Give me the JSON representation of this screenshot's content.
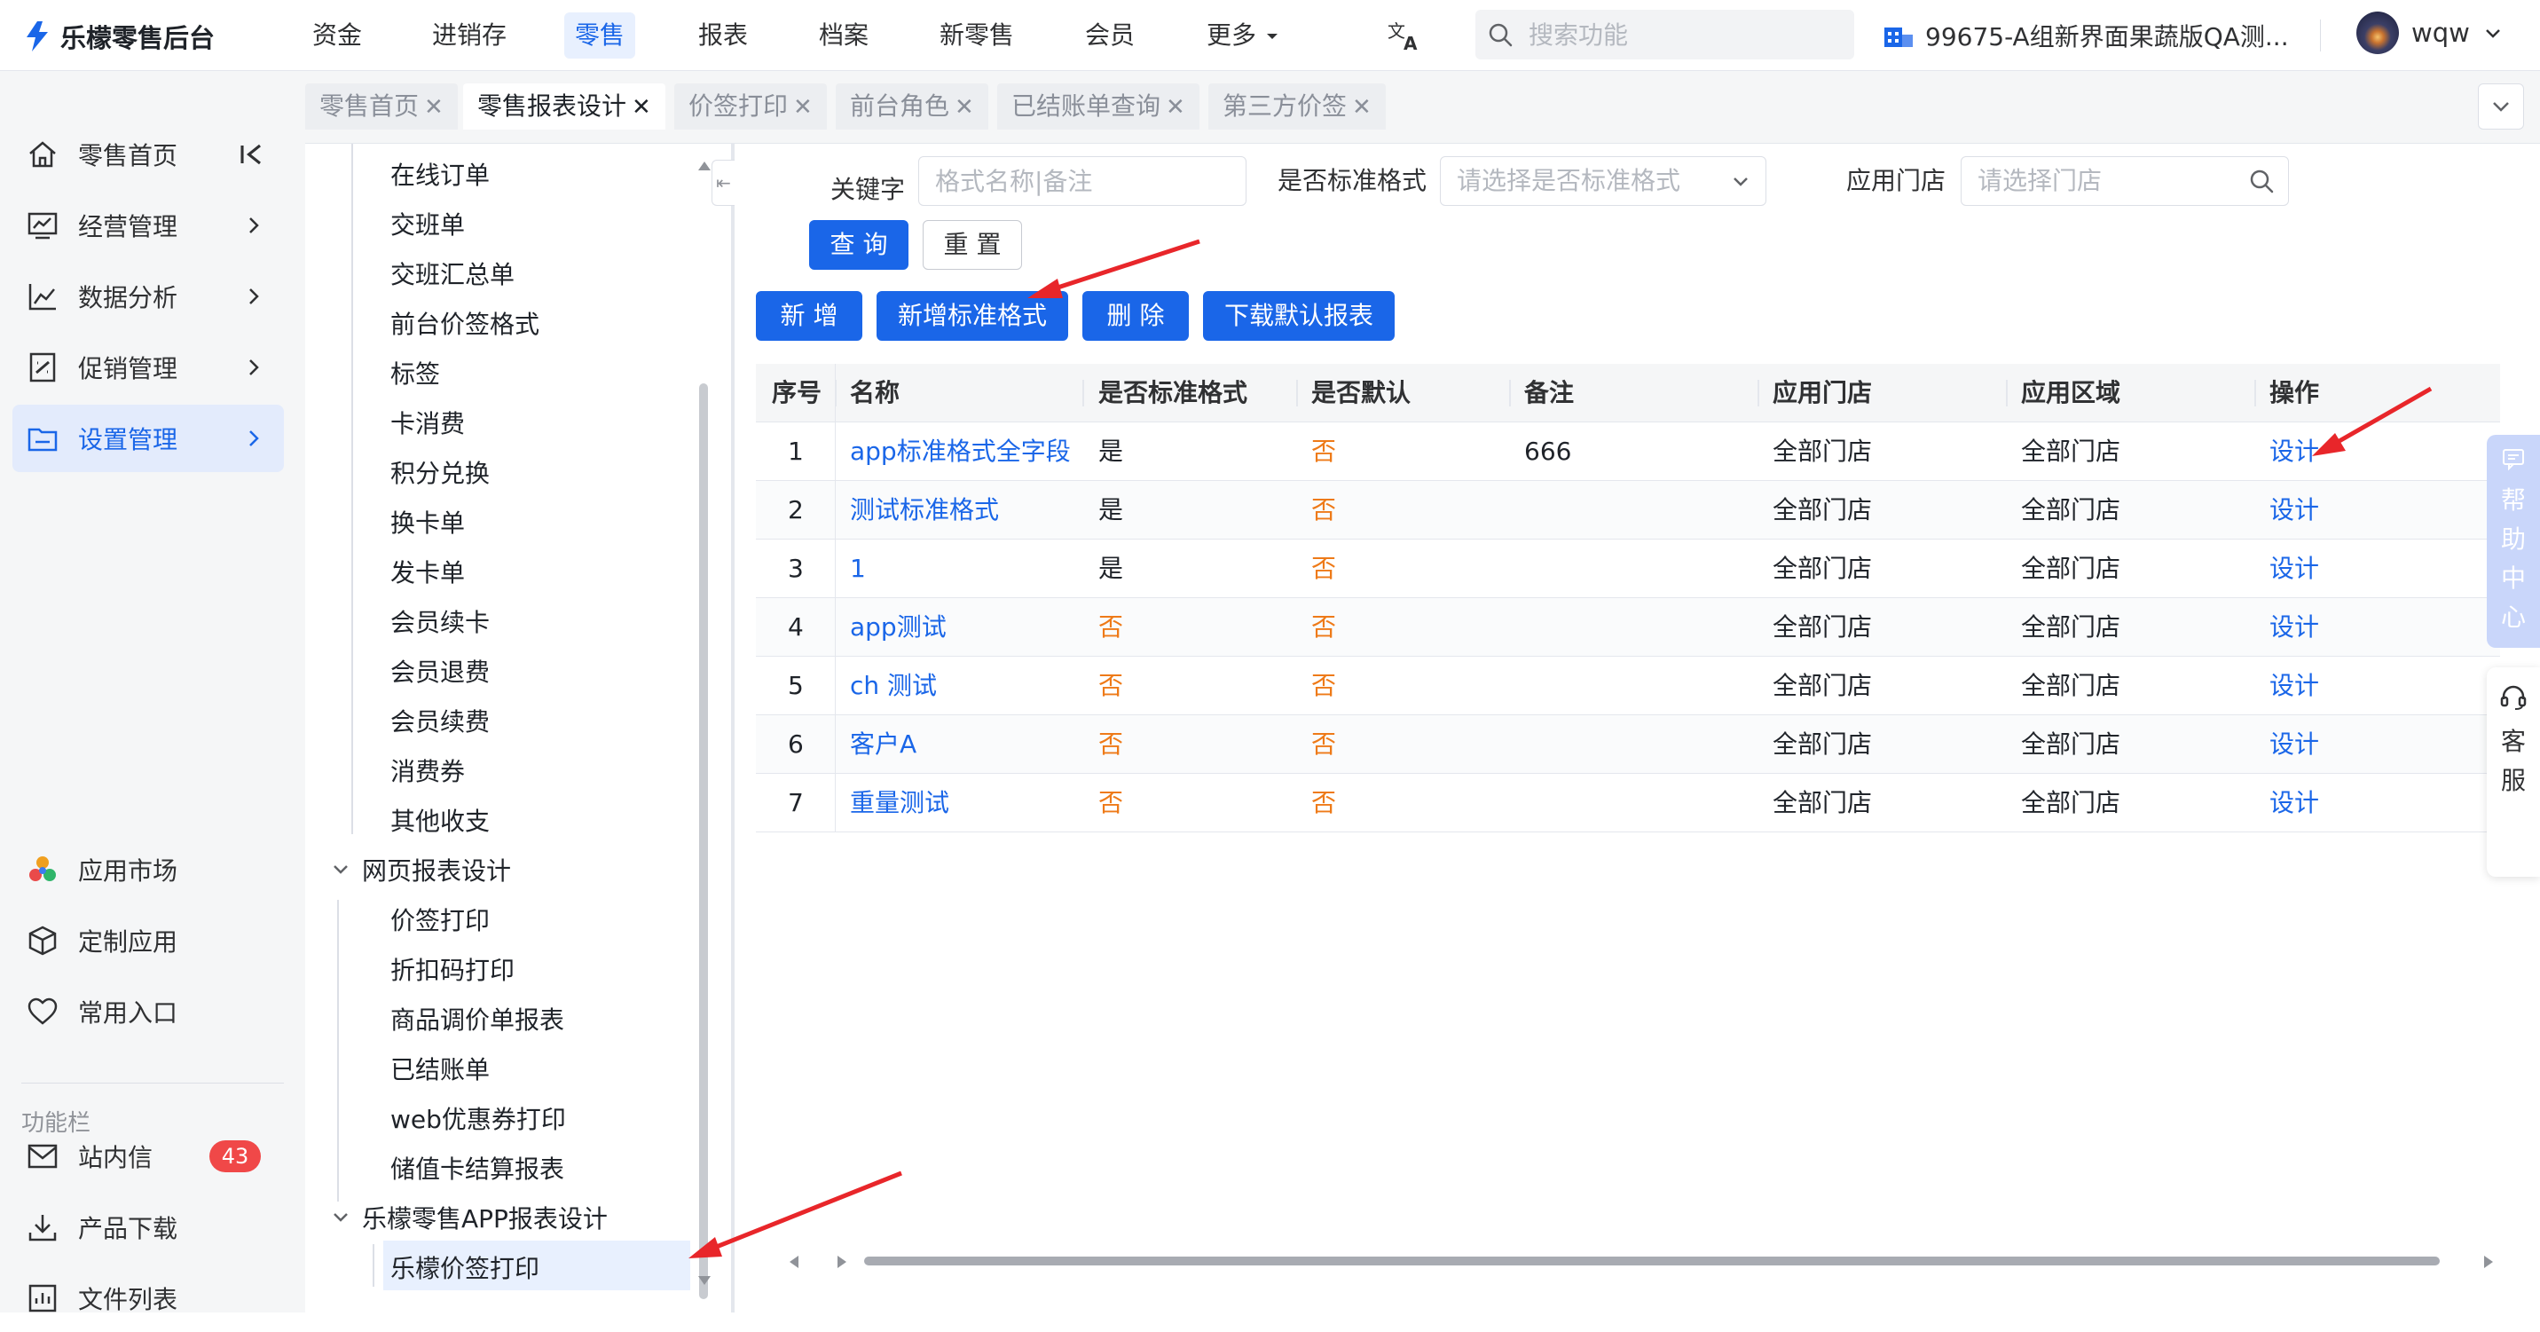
{
  "app": {
    "name": "乐檬零售后台"
  },
  "topnav": {
    "items": [
      "资金",
      "进销存",
      "零售",
      "报表",
      "档案",
      "新零售",
      "会员",
      "更多"
    ],
    "active": "零售",
    "search_placeholder": "搜索功能",
    "store": "99675-A组新界面果蔬版QA测...",
    "user": "wqw"
  },
  "sidebar": {
    "main_items": [
      {
        "label": "零售首页",
        "icon": "home-icon"
      },
      {
        "label": "经营管理",
        "icon": "chart-board-icon"
      },
      {
        "label": "数据分析",
        "icon": "line-chart-icon"
      },
      {
        "label": "促销管理",
        "icon": "promotion-icon"
      },
      {
        "label": "设置管理",
        "icon": "folder-icon"
      }
    ],
    "bottom_items": [
      {
        "label": "应用市场",
        "icon": "app-market-icon"
      },
      {
        "label": "定制应用",
        "icon": "cube-icon"
      },
      {
        "label": "常用入口",
        "icon": "heart-icon"
      }
    ],
    "section_label": "功能栏",
    "func_items": [
      {
        "label": "站内信",
        "icon": "mail-icon",
        "badge": "43"
      },
      {
        "label": "产品下载",
        "icon": "download-icon"
      },
      {
        "label": "文件列表",
        "icon": "file-list-icon"
      }
    ]
  },
  "tabs": [
    {
      "label": "零售首页",
      "active": false
    },
    {
      "label": "零售报表设计",
      "active": true
    },
    {
      "label": "价签打印",
      "active": false
    },
    {
      "label": "前台角色",
      "active": false
    },
    {
      "label": "已结账单查询",
      "active": false
    },
    {
      "label": "第三方价签",
      "active": false
    }
  ],
  "tree": {
    "items_top": [
      "在线订单",
      "交班单",
      "交班汇总单",
      "前台价签格式",
      "标签",
      "卡消费",
      "积分兑换",
      "换卡单",
      "发卡单",
      "会员续卡",
      "会员退费",
      "会员续费",
      "消费券",
      "其他收支"
    ],
    "group_web": "网页报表设计",
    "items_web": [
      "价签打印",
      "折扣码打印",
      "商品调价单报表",
      "已结账单",
      "web优惠券打印",
      "储值卡结算报表"
    ],
    "group_app": "乐檬零售APP报表设计",
    "items_app": [
      "乐檬价签打印"
    ]
  },
  "filters": {
    "keyword_label": "关键字",
    "keyword_placeholder": "格式名称|备注",
    "standard_label": "是否标准格式",
    "standard_placeholder": "请选择是否标准格式",
    "store_label": "应用门店",
    "store_placeholder": "请选择门店",
    "query_btn": "查 询",
    "reset_btn": "重 置"
  },
  "actions": {
    "add": "新 增",
    "add_standard": "新增标准格式",
    "delete": "删 除",
    "download_default": "下载默认报表"
  },
  "table": {
    "headers": [
      "序号",
      "名称",
      "是否标准格式",
      "是否默认",
      "备注",
      "应用门店",
      "应用区域",
      "操作"
    ],
    "rows": [
      {
        "no": "1",
        "name": "app标准格式全字段",
        "standard": "是",
        "default": "否",
        "remark": "666",
        "store": "全部门店",
        "region": "全部门店",
        "op": "设计"
      },
      {
        "no": "2",
        "name": "测试标准格式",
        "standard": "是",
        "default": "否",
        "remark": "",
        "store": "全部门店",
        "region": "全部门店",
        "op": "设计"
      },
      {
        "no": "3",
        "name": "1",
        "standard": "是",
        "default": "否",
        "remark": "",
        "store": "全部门店",
        "region": "全部门店",
        "op": "设计"
      },
      {
        "no": "4",
        "name": "app测试",
        "standard": "否",
        "default": "否",
        "remark": "",
        "store": "全部门店",
        "region": "全部门店",
        "op": "设计"
      },
      {
        "no": "5",
        "name": "ch 测试",
        "standard": "否",
        "default": "否",
        "remark": "",
        "store": "全部门店",
        "region": "全部门店",
        "op": "设计"
      },
      {
        "no": "6",
        "name": "客户A",
        "standard": "否",
        "default": "否",
        "remark": "",
        "store": "全部门店",
        "region": "全部门店",
        "op": "设计"
      },
      {
        "no": "7",
        "name": "重量测试",
        "standard": "否",
        "default": "否",
        "remark": "",
        "store": "全部门店",
        "region": "全部门店",
        "op": "设计"
      }
    ]
  },
  "float": {
    "help": [
      "帮",
      "助",
      "中",
      "心"
    ],
    "service": [
      "客",
      "服"
    ]
  },
  "colors": {
    "primary": "#1a66e8",
    "orange": "#ee7a18",
    "annotation_red": "#e8262a",
    "badge_red": "#f04848"
  }
}
